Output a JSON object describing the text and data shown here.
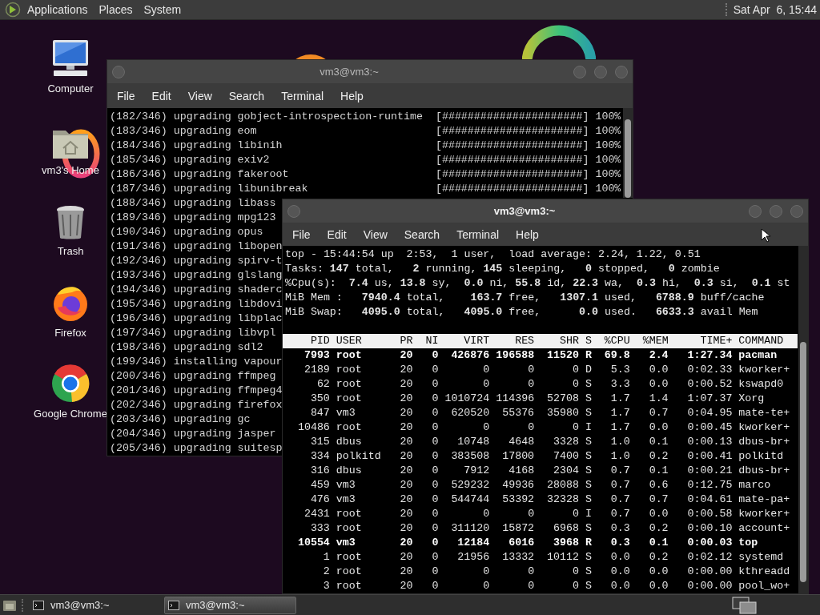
{
  "top_panel": {
    "menus": [
      "Applications",
      "Places",
      "System"
    ],
    "clock": "Sat Apr  6, 15:44"
  },
  "desktop_icons": [
    {
      "label": "Computer",
      "kind": "computer"
    },
    {
      "label": "vm3's Home",
      "kind": "home"
    },
    {
      "label": "Trash",
      "kind": "trash"
    },
    {
      "label": "Firefox",
      "kind": "firefox"
    },
    {
      "label": "Google Chrome",
      "kind": "chrome"
    }
  ],
  "back_terminal": {
    "title": "vm3@vm3:~",
    "active": false,
    "menus": [
      "File",
      "Edit",
      "View",
      "Search",
      "Terminal",
      "Help"
    ],
    "lines": [
      {
        "text": "(182/346) upgrading gobject-introspection-runtime",
        "bar": "[######################]",
        "percent": "100%"
      },
      {
        "text": "(183/346) upgrading eom",
        "bar": "[######################]",
        "percent": "100%"
      },
      {
        "text": "(184/346) upgrading libinih",
        "bar": "[######################]",
        "percent": "100%"
      },
      {
        "text": "(185/346) upgrading exiv2",
        "bar": "[######################]",
        "percent": "100%"
      },
      {
        "text": "(186/346) upgrading fakeroot",
        "bar": "[######################]",
        "percent": "100%"
      },
      {
        "text": "(187/346) upgrading libunibreak",
        "bar": "[######################]",
        "percent": "100%"
      },
      {
        "text": "(188/346) upgrading libass"
      },
      {
        "text": "(189/346) upgrading mpg123"
      },
      {
        "text": "(190/346) upgrading opus"
      },
      {
        "text": "(191/346) upgrading libopen"
      },
      {
        "text": "(192/346) upgrading spirv-t"
      },
      {
        "text": "(193/346) upgrading glslang"
      },
      {
        "text": "(194/346) upgrading shaderc"
      },
      {
        "text": "(195/346) upgrading libdovi"
      },
      {
        "text": "(196/346) upgrading libplac"
      },
      {
        "text": "(197/346) upgrading libvpl"
      },
      {
        "text": "(198/346) upgrading sdl2"
      },
      {
        "text": "(199/346) installing vapour"
      },
      {
        "text": "(200/346) upgrading ffmpeg"
      },
      {
        "text": "(201/346) upgrading ffmpeg4"
      },
      {
        "text": "(202/346) upgrading firefox"
      },
      {
        "text": "(203/346) upgrading gc"
      },
      {
        "text": "(204/346) upgrading jasper"
      },
      {
        "text": "(205/346) upgrading suitesp"
      }
    ]
  },
  "front_terminal": {
    "title": "vm3@vm3:~",
    "active": true,
    "menus": [
      "File",
      "Edit",
      "View",
      "Search",
      "Terminal",
      "Help"
    ],
    "summary": [
      "top - 15:44:54 up  2:53,  1 user,  load average: 2.24, 1.22, 0.51",
      "Tasks: **147** total,   **2** running, **145** sleeping,   **0** stopped,   **0** zombie",
      "%Cpu(s):  **7.4** us, **13.8** sy,  **0.0** ni, **55.8** id, **22.3** wa,  **0.3** hi,  **0.3** si,  **0.1** st",
      "MiB Mem :   **7940.4** total,    **163.7** free,   **1307.1** used,   **6788.9** buff/cache",
      "MiB Swap:   **4095.0** total,   **4095.0** free,      **0.0** used.   **6633.3** avail Mem"
    ],
    "table": {
      "columns": [
        "PID",
        "USER",
        "PR",
        "NI",
        "VIRT",
        "RES",
        "SHR",
        "S",
        "%CPU",
        "%MEM",
        "TIME+",
        "COMMAND"
      ],
      "rows": [
        {
          "bold": true,
          "cells": [
            "7993",
            "root",
            "20",
            "0",
            "426876",
            "196588",
            "11520",
            "R",
            "69.8",
            "2.4",
            "1:27.34",
            "pacman"
          ]
        },
        {
          "bold": false,
          "cells": [
            "2189",
            "root",
            "20",
            "0",
            "0",
            "0",
            "0",
            "D",
            "5.3",
            "0.0",
            "0:02.33",
            "kworker+"
          ]
        },
        {
          "bold": false,
          "cells": [
            "62",
            "root",
            "20",
            "0",
            "0",
            "0",
            "0",
            "S",
            "3.3",
            "0.0",
            "0:00.52",
            "kswapd0"
          ]
        },
        {
          "bold": false,
          "cells": [
            "350",
            "root",
            "20",
            "0",
            "1010724",
            "114396",
            "52708",
            "S",
            "1.7",
            "1.4",
            "1:07.37",
            "Xorg"
          ]
        },
        {
          "bold": false,
          "cells": [
            "847",
            "vm3",
            "20",
            "0",
            "620520",
            "55376",
            "35980",
            "S",
            "1.7",
            "0.7",
            "0:04.95",
            "mate-te+"
          ]
        },
        {
          "bold": false,
          "cells": [
            "10486",
            "root",
            "20",
            "0",
            "0",
            "0",
            "0",
            "I",
            "1.7",
            "0.0",
            "0:00.45",
            "kworker+"
          ]
        },
        {
          "bold": false,
          "cells": [
            "315",
            "dbus",
            "20",
            "0",
            "10748",
            "4648",
            "3328",
            "S",
            "1.0",
            "0.1",
            "0:00.13",
            "dbus-br+"
          ]
        },
        {
          "bold": false,
          "cells": [
            "334",
            "polkitd",
            "20",
            "0",
            "383508",
            "17800",
            "7400",
            "S",
            "1.0",
            "0.2",
            "0:00.41",
            "polkitd"
          ]
        },
        {
          "bold": false,
          "cells": [
            "316",
            "dbus",
            "20",
            "0",
            "7912",
            "4168",
            "2304",
            "S",
            "0.7",
            "0.1",
            "0:00.21",
            "dbus-br+"
          ]
        },
        {
          "bold": false,
          "cells": [
            "459",
            "vm3",
            "20",
            "0",
            "529232",
            "49936",
            "28088",
            "S",
            "0.7",
            "0.6",
            "0:12.75",
            "marco"
          ]
        },
        {
          "bold": false,
          "cells": [
            "476",
            "vm3",
            "20",
            "0",
            "544744",
            "53392",
            "32328",
            "S",
            "0.7",
            "0.7",
            "0:04.61",
            "mate-pa+"
          ]
        },
        {
          "bold": false,
          "cells": [
            "2431",
            "root",
            "20",
            "0",
            "0",
            "0",
            "0",
            "I",
            "0.7",
            "0.0",
            "0:00.58",
            "kworker+"
          ]
        },
        {
          "bold": false,
          "cells": [
            "333",
            "root",
            "20",
            "0",
            "311120",
            "15872",
            "6968",
            "S",
            "0.3",
            "0.2",
            "0:00.10",
            "account+"
          ]
        },
        {
          "bold": true,
          "cells": [
            "10554",
            "vm3",
            "20",
            "0",
            "12184",
            "6016",
            "3968",
            "R",
            "0.3",
            "0.1",
            "0:00.03",
            "top"
          ]
        },
        {
          "bold": false,
          "cells": [
            "1",
            "root",
            "20",
            "0",
            "21956",
            "13332",
            "10112",
            "S",
            "0.0",
            "0.2",
            "0:02.12",
            "systemd"
          ]
        },
        {
          "bold": false,
          "cells": [
            "2",
            "root",
            "20",
            "0",
            "0",
            "0",
            "0",
            "S",
            "0.0",
            "0.0",
            "0:00.00",
            "kthreadd"
          ]
        },
        {
          "bold": false,
          "cells": [
            "3",
            "root",
            "20",
            "0",
            "0",
            "0",
            "0",
            "S",
            "0.0",
            "0.0",
            "0:00.00",
            "pool_wo+"
          ]
        }
      ]
    }
  },
  "taskbar": {
    "items": [
      {
        "label": "vm3@vm3:~",
        "selected": false
      },
      {
        "label": "vm3@vm3:~",
        "selected": true
      }
    ]
  }
}
